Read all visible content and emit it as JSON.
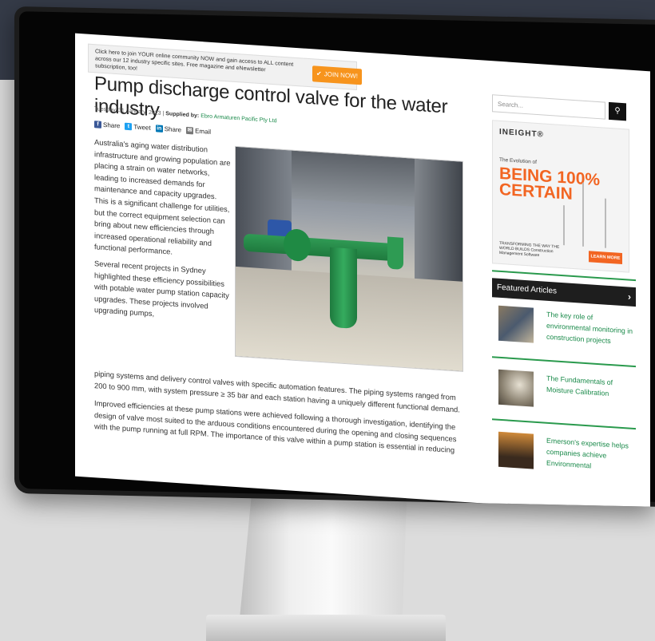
{
  "banner": {
    "text": "Click here to join YOUR online community NOW and gain access to ALL content across our 12 industry specific sites. Free magazine and eNewsletter subscription, too!",
    "button": "JOIN NOW!"
  },
  "article": {
    "title": "Pump discharge control valve for the water industry",
    "date": "Tuesday, 31 January, 2023",
    "supplied_by_label": "Supplied by:",
    "supplier": "Ebro Armaturen Pacific Pty Ltd",
    "share": {
      "facebook": "Share",
      "twitter": "Tweet",
      "linkedin": "Share",
      "email": "Email"
    },
    "paragraph1": "Australia's aging water distribution infrastructure and growing population are placing a strain on water networks, leading to increased demands for maintenance and capacity upgrades. This is a significant challenge for utilities, but the correct equipment selection can bring about new efficiencies through increased operational reliability and functional performance.",
    "paragraph2_start": "Several recent projects in Sydney highlighted these efficiency possibilities with potable water pump station capacity upgrades. These projects involved upgrading pumps,",
    "paragraph2_end": "piping systems and delivery control valves with specific automation features. The piping systems ranged from 200 to 900 mm, with system pressure ≥ 35 bar and each station having a uniquely different functional demand.",
    "paragraph3": "Improved efficiencies at these pump stations were achieved following a thorough investigation, identifying the design of valve most suited to the arduous conditions encountered during the opening and closing sequences with the pump running at full RPM. The importance of this valve within a pump station is essential in reducing"
  },
  "sidebar": {
    "search_placeholder": "Search...",
    "ad": {
      "brand": "INEIGHT®",
      "subtitle": "The Evolution of",
      "headline1": "BEING 100%",
      "headline2": "CERTAIN",
      "small_text": "TRANSFORMING THE WAY THE WORLD BUILDS Construction Management Software",
      "button": "LEARN MORE"
    },
    "featured_header": "Featured Articles",
    "featured": [
      {
        "title": "The key role of environmental monitoring in construction projects"
      },
      {
        "title": "The Fundamentals of Moisture Calibration"
      },
      {
        "title": "Emerson's expertise helps companies achieve Environmental"
      }
    ]
  },
  "colors": {
    "accent_green": "#1a8a4a",
    "orange": "#f7941d",
    "monitor_bg": "#353b48"
  }
}
